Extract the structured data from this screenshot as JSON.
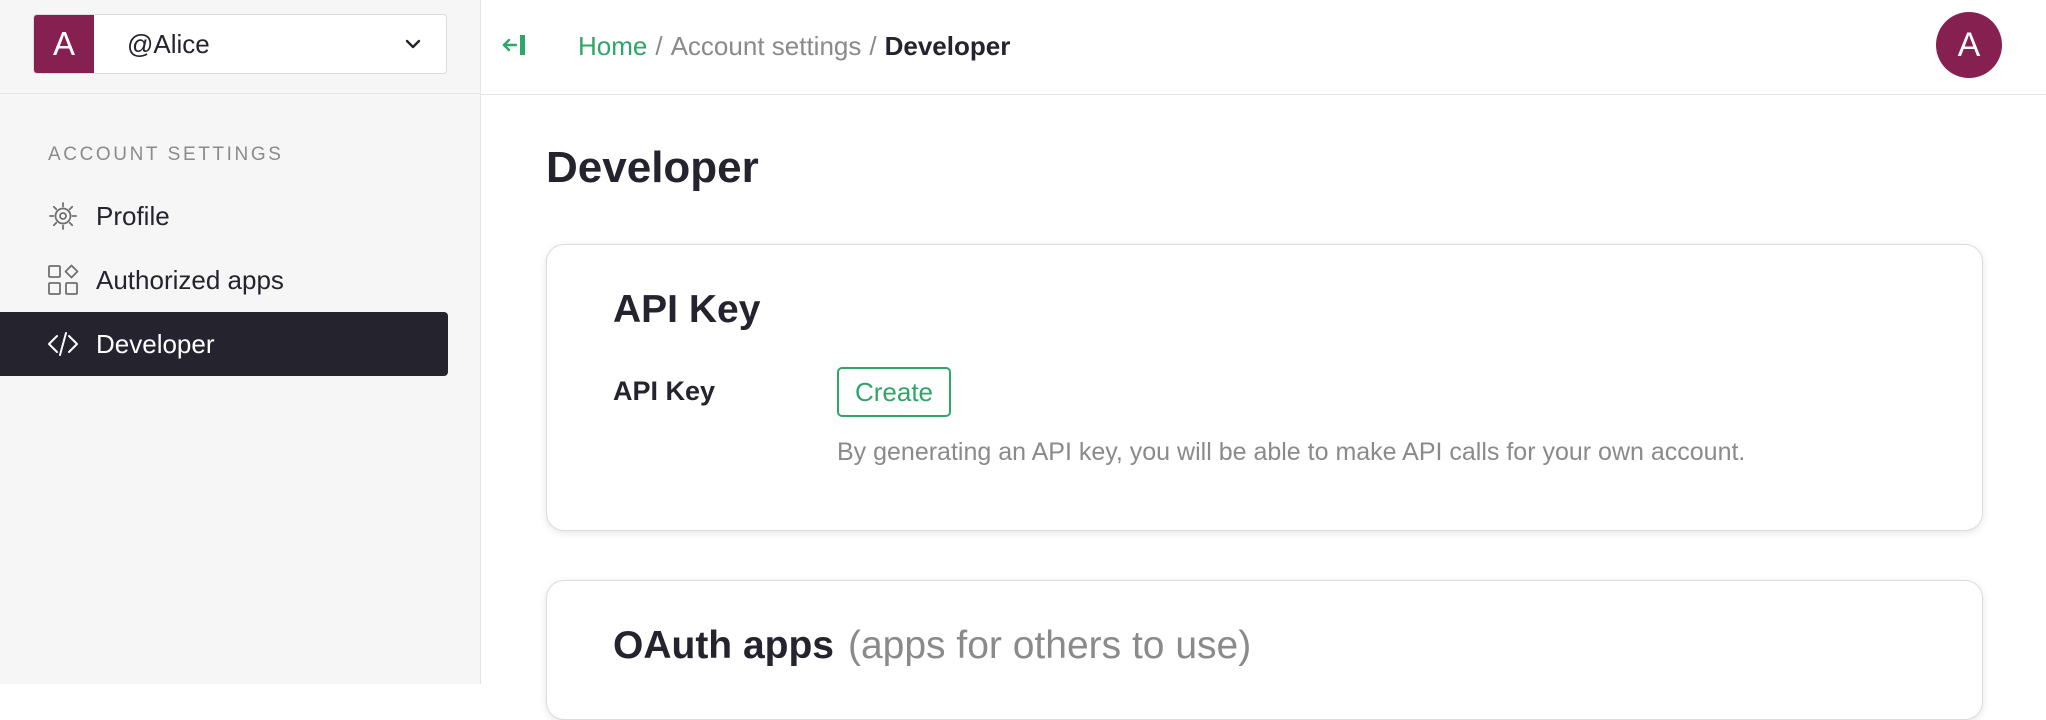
{
  "account_switcher": {
    "avatar_letter": "A",
    "username": "@Alice",
    "avatar_color": "#862050"
  },
  "sidebar": {
    "section_label": "ACCOUNT SETTINGS",
    "items": [
      {
        "label": "Profile",
        "icon": "gear-icon",
        "active": false
      },
      {
        "label": "Authorized apps",
        "icon": "apps-grid-icon",
        "active": false
      },
      {
        "label": "Developer",
        "icon": "code-icon",
        "active": true
      }
    ]
  },
  "topbar": {
    "collapse_icon": "collapse-sidebar-icon",
    "breadcrumb": {
      "home": "Home",
      "middle": "Account settings",
      "current": "Developer",
      "separator": "/"
    },
    "user_avatar_letter": "A"
  },
  "main": {
    "title": "Developer",
    "api_card": {
      "title": "API Key",
      "field_label": "API Key",
      "create_button": "Create",
      "help_text": "By generating an API key, you will be able to make API calls for your own account."
    },
    "oauth_card": {
      "title": "OAuth apps",
      "subtitle": "(apps for others to use)"
    }
  },
  "colors": {
    "accent_green": "#2fa56a",
    "brand_avatar": "#862050",
    "active_nav_bg": "#24232e",
    "sidebar_bg": "#f6f6f6"
  }
}
